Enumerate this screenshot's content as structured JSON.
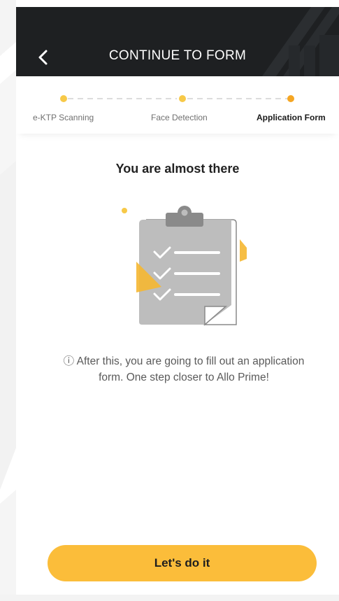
{
  "header": {
    "title": "CONTINUE TO FORM",
    "back_icon": "chevron-left-icon"
  },
  "stepper": {
    "steps": [
      {
        "label": "e-KTP Scanning",
        "active": false
      },
      {
        "label": "Face Detection",
        "active": false
      },
      {
        "label": "Application Form",
        "active": true
      }
    ],
    "colors": {
      "dot": "#f7c948",
      "dot_active": "#f5a623"
    }
  },
  "content": {
    "heading": "You are almost there",
    "illustration_icon": "clipboard-checklist-icon",
    "info_icon": "info-circle-icon",
    "info_text": "After this, you are going to fill out an application form. One step closer to Allo Prime!"
  },
  "cta": {
    "label": "Let's do it",
    "color": "#fbbd3a"
  },
  "colors": {
    "header_bg": "#1e2022",
    "accent": "#fbbd3a"
  }
}
